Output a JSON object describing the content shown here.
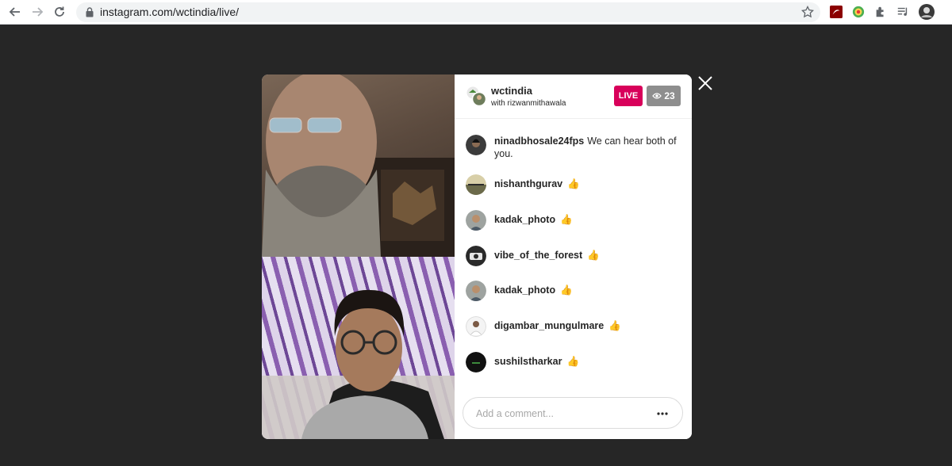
{
  "browser": {
    "url": "instagram.com/wctindia/live/"
  },
  "live": {
    "host": "wctindia",
    "with_label": "with rizwanmithawala",
    "live_badge": "LIVE",
    "viewer_count": "23"
  },
  "comments": [
    {
      "user": "ninadbhosale24fps",
      "text": "We can hear both of you."
    },
    {
      "user": "nishanthgurav",
      "text": "👍"
    },
    {
      "user": "kadak_photo",
      "text": "👍"
    },
    {
      "user": "vibe_of_the_forest",
      "text": "👍"
    },
    {
      "user": "kadak_photo",
      "text": "👍"
    },
    {
      "user": "digambar_mungulmare",
      "text": "👍"
    },
    {
      "user": "sushilstharkar",
      "text": "👍"
    }
  ],
  "comment_input": {
    "placeholder": "Add a comment..."
  },
  "colors": {
    "live": "#d8005a",
    "background": "#262626"
  }
}
